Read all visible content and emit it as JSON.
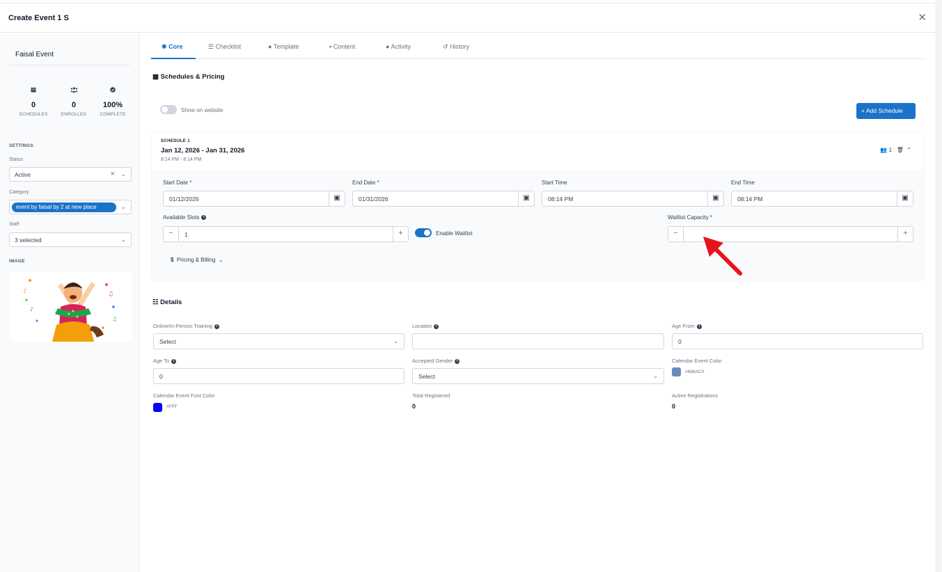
{
  "modal": {
    "title": "Create Event 1 S",
    "close_icon": "✕"
  },
  "sidebar": {
    "event_name": "Faisal Event",
    "stats": [
      {
        "icon": "calendar-icon",
        "value": "0",
        "label": "SCHEDULES"
      },
      {
        "icon": "users-icon",
        "value": "0",
        "label": "ENROLLED"
      },
      {
        "icon": "check-circle-icon",
        "value": "100%",
        "label": "COMPLETE"
      }
    ],
    "settings_heading": "SETTINGS",
    "status": {
      "label": "Status",
      "value": "Active"
    },
    "category": {
      "label": "Category",
      "value": "event by faisal by 2 at new place"
    },
    "staff": {
      "label": "Staff",
      "value": "3 selected"
    },
    "image_heading": "IMAGE"
  },
  "tabs": [
    {
      "label": "Core",
      "icon": "gear-icon",
      "active": true
    },
    {
      "label": "Checklist",
      "icon": "list-icon",
      "active": false
    },
    {
      "label": "Template",
      "icon": "palette-icon",
      "active": false
    },
    {
      "label": "Content",
      "icon": "file-icon",
      "active": false
    },
    {
      "label": "Activity",
      "icon": "chat-icon",
      "active": false
    },
    {
      "label": "History",
      "icon": "history-icon",
      "active": false
    }
  ],
  "schedules": {
    "heading": "Schedules & Pricing",
    "show_on_website": {
      "label": "Show on website",
      "enabled": false
    },
    "add_button": "+ Add Schedule",
    "schedule": {
      "caption": "SCHEDULE 1",
      "dates": "Jan 12, 2026 - Jan 31, 2026",
      "time": "8:14 PM - 8:14 PM",
      "participants": "1",
      "start_date": {
        "label": "Start Date *",
        "value": "01/12/2026"
      },
      "end_date": {
        "label": "End Date *",
        "value": "01/31/2026"
      },
      "start_time": {
        "label": "Start Time",
        "value": "08:14 PM"
      },
      "end_time": {
        "label": "End Time",
        "value": "08:14 PM"
      },
      "available_slots": {
        "label": "Available Slots",
        "value": "1"
      },
      "enable_waitlist": {
        "label": "Enable Waitlist",
        "enabled": true
      },
      "waitlist_capacity": {
        "label": "Waitlist Capacity *",
        "value": ""
      },
      "pricing_toggle": "Pricing & Billing"
    }
  },
  "details": {
    "heading": "Details",
    "training": {
      "label": "Online/In-Person Training",
      "value": "Select"
    },
    "location": {
      "label": "Location",
      "value": ""
    },
    "age_from": {
      "label": "Age From",
      "value": "0"
    },
    "age_to": {
      "label": "Age To",
      "value": "0"
    },
    "accepted_gender": {
      "label": "Accepted Gender",
      "value": "Select"
    },
    "calendar_color": {
      "label": "Calendar Event Color",
      "value": "#688AC0"
    },
    "font_color": {
      "label": "Calendar Event Font Color",
      "value": "#FFF",
      "swatch": "#0000ff"
    },
    "total_registered": {
      "label": "Total Registered",
      "value": "0"
    },
    "active_registrations": {
      "label": "Active Registrations",
      "value": "0"
    }
  },
  "colors": {
    "accent": "#1a73c8",
    "arrow": "#e8121b"
  }
}
